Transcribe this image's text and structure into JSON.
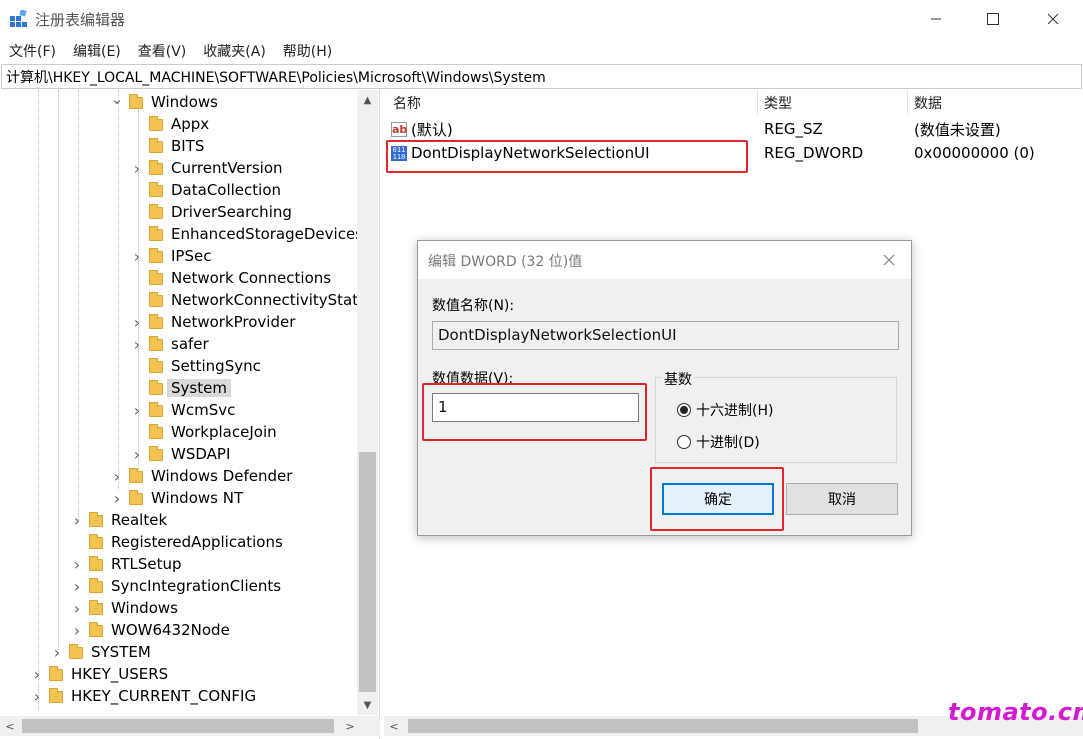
{
  "window": {
    "title": "注册表编辑器"
  },
  "menu": [
    "文件(F)",
    "编辑(E)",
    "查看(V)",
    "收藏夹(A)",
    "帮助(H)"
  ],
  "address": "计算机\\HKEY_LOCAL_MACHINE\\SOFTWARE\\Policies\\Microsoft\\Windows\\System",
  "tree": [
    {
      "label": "Windows",
      "state": "expanded",
      "level": 4
    },
    {
      "label": "Appx",
      "state": "leaf",
      "level": 5
    },
    {
      "label": "BITS",
      "state": "leaf",
      "level": 5
    },
    {
      "label": "CurrentVersion",
      "state": "collapsed",
      "level": 5
    },
    {
      "label": "DataCollection",
      "state": "leaf",
      "level": 5
    },
    {
      "label": "DriverSearching",
      "state": "leaf",
      "level": 5
    },
    {
      "label": "EnhancedStorageDevices",
      "state": "leaf",
      "level": 5
    },
    {
      "label": "IPSec",
      "state": "collapsed",
      "level": 5
    },
    {
      "label": "Network Connections",
      "state": "leaf",
      "level": 5
    },
    {
      "label": "NetworkConnectivityStatu",
      "state": "leaf",
      "level": 5
    },
    {
      "label": "NetworkProvider",
      "state": "collapsed",
      "level": 5
    },
    {
      "label": "safer",
      "state": "collapsed",
      "level": 5
    },
    {
      "label": "SettingSync",
      "state": "leaf",
      "level": 5
    },
    {
      "label": "System",
      "state": "leaf",
      "level": 5,
      "selected": true
    },
    {
      "label": "WcmSvc",
      "state": "collapsed",
      "level": 5
    },
    {
      "label": "WorkplaceJoin",
      "state": "leaf",
      "level": 5
    },
    {
      "label": "WSDAPI",
      "state": "collapsed",
      "level": 5
    },
    {
      "label": "Windows Defender",
      "state": "collapsed",
      "level": 4
    },
    {
      "label": "Windows NT",
      "state": "collapsed",
      "level": 4
    },
    {
      "label": "Realtek",
      "state": "collapsed",
      "level": 3
    },
    {
      "label": "RegisteredApplications",
      "state": "leaf",
      "level": 3
    },
    {
      "label": "RTLSetup",
      "state": "collapsed",
      "level": 3
    },
    {
      "label": "SyncIntegrationClients",
      "state": "collapsed",
      "level": 3
    },
    {
      "label": "Windows",
      "state": "collapsed",
      "level": 3
    },
    {
      "label": "WOW6432Node",
      "state": "collapsed",
      "level": 3
    },
    {
      "label": "SYSTEM",
      "state": "collapsed",
      "level": 2
    },
    {
      "label": "HKEY_USERS",
      "state": "collapsed",
      "level": 1
    },
    {
      "label": "HKEY_CURRENT_CONFIG",
      "state": "collapsed",
      "level": 1
    }
  ],
  "list": {
    "headers": {
      "name": "名称",
      "type": "类型",
      "data": "数据"
    },
    "rows": [
      {
        "icon": "string-value-icon",
        "name": "(默认)",
        "type": "REG_SZ",
        "data": "(数值未设置)"
      },
      {
        "icon": "dword-value-icon",
        "name": "DontDisplayNetworkSelectionUI",
        "type": "REG_DWORD",
        "data": "0x00000000 (0)"
      }
    ]
  },
  "dialog": {
    "title": "编辑 DWORD (32 位)值",
    "name_label": "数值名称(N):",
    "name_value": "DontDisplayNetworkSelectionUI",
    "data_label": "数值数据(V):",
    "data_value": "1",
    "base_label": "基数",
    "hex_label": "十六进制(H)",
    "dec_label": "十进制(D)",
    "selected_base": "hex",
    "ok_label": "确定",
    "cancel_label": "取消"
  },
  "watermark": "tomato.cm",
  "colors": {
    "highlight_box": "#e3262c",
    "watermark": "#d51bd1",
    "folder": "#f3c352"
  }
}
